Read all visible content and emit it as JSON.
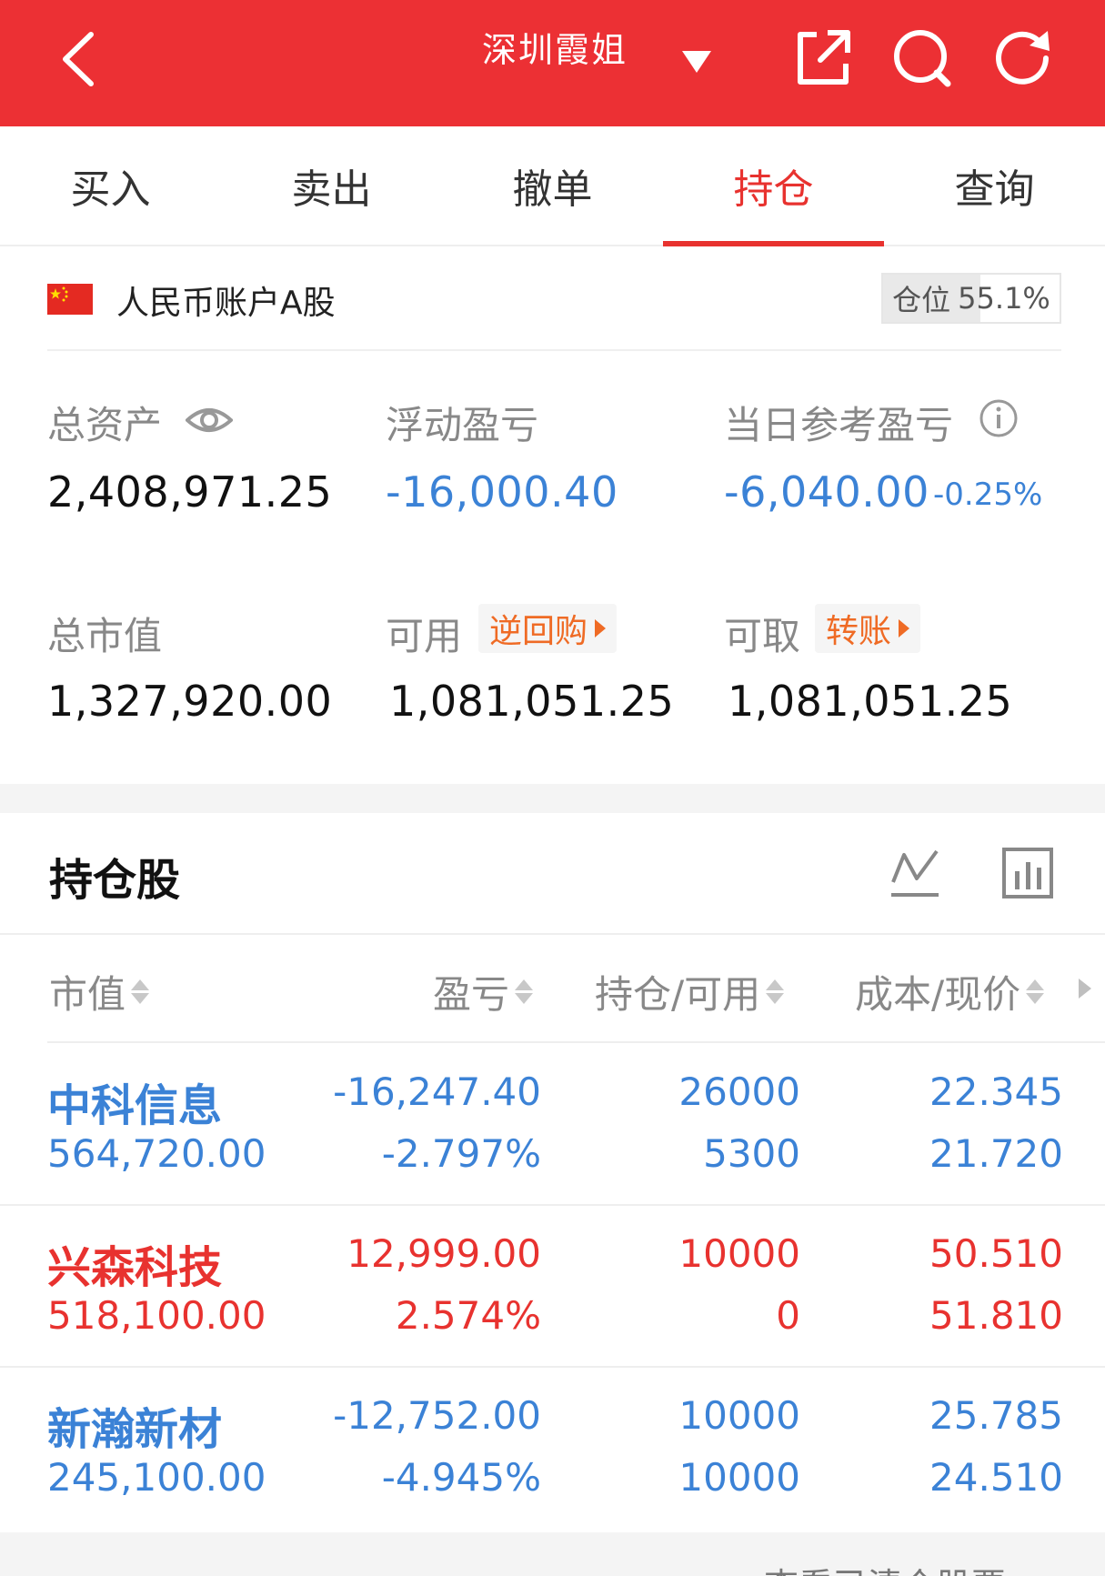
{
  "header": {
    "title": "深圳霞姐",
    "icons": [
      "back-icon",
      "dropdown-caret-icon",
      "share-icon",
      "search-icon",
      "refresh-icon"
    ],
    "bg_color": "#ec3034"
  },
  "tabs": [
    {
      "label": "买入",
      "active": false
    },
    {
      "label": "卖出",
      "active": false
    },
    {
      "label": "撤单",
      "active": false
    },
    {
      "label": "持仓",
      "active": true
    },
    {
      "label": "查询",
      "active": false
    }
  ],
  "account": {
    "name": "人民币账户A股",
    "position_label": "仓位",
    "position_value": "55.1%"
  },
  "stats": {
    "total_assets_label": "总资产",
    "total_assets": "2,408,971.25",
    "floating_pl_label": "浮动盈亏",
    "floating_pl": "-16,000.40",
    "today_pl_label": "当日参考盈亏",
    "today_pl": "-6,040.00",
    "today_pl_pct": "-0.25%",
    "market_value_label": "总市值",
    "market_value": "1,327,920.00",
    "available_label": "可用",
    "reverse_repo_label": "逆回购",
    "available": "1,081,051.25",
    "withdrawable_label": "可取",
    "transfer_label": "转账",
    "withdrawable": "1,081,051.25"
  },
  "holdings": {
    "title": "持仓股",
    "columns": [
      "市值",
      "盈亏",
      "持仓/可用",
      "成本/现价"
    ],
    "rows": [
      {
        "name": "中科信息",
        "market_value": "564,720.00",
        "pl": "-16,247.40",
        "pl_pct": "-2.797%",
        "position": "26000",
        "available": "5300",
        "cost": "22.345",
        "price": "21.720",
        "trend": "down"
      },
      {
        "name": "兴森科技",
        "market_value": "518,100.00",
        "pl": "12,999.00",
        "pl_pct": "2.574%",
        "position": "10000",
        "available": "0",
        "cost": "50.510",
        "price": "51.810",
        "trend": "up"
      },
      {
        "name": "新瀚新材",
        "market_value": "245,100.00",
        "pl": "-12,752.00",
        "pl_pct": "-4.945%",
        "position": "10000",
        "available": "10000",
        "cost": "25.785",
        "price": "24.510",
        "trend": "down"
      }
    ]
  },
  "footer": {
    "link": "查看已清仓股票 >"
  },
  "colors": {
    "red": "#e8322f",
    "blue": "#3b82d6",
    "orange": "#ef6b25"
  }
}
